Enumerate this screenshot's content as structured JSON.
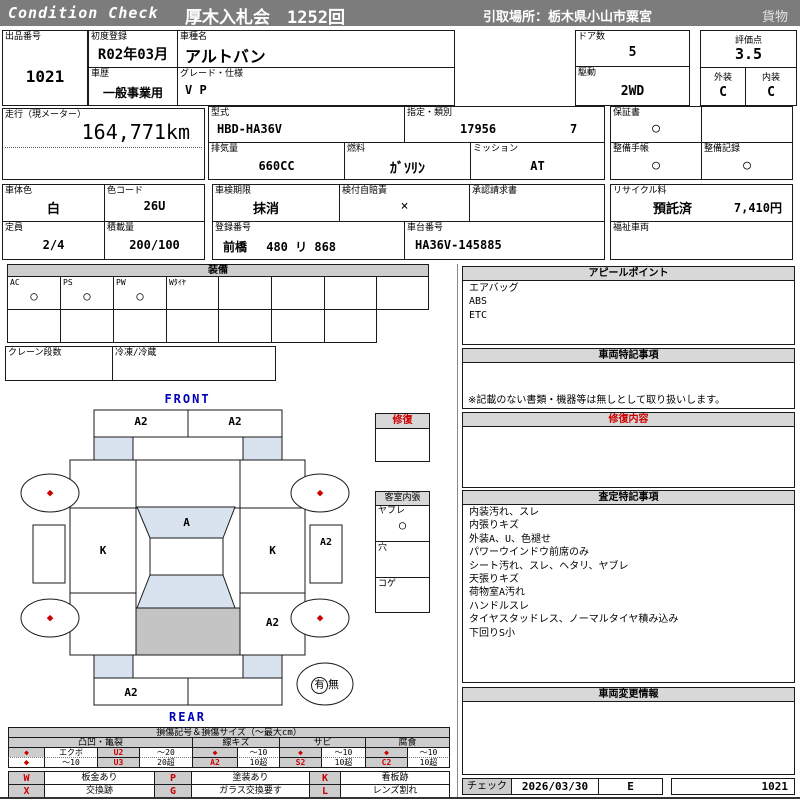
{
  "header": {
    "brand": "Condition Check",
    "auction": "厚木入札会　1252回",
    "pickup": "引取場所：栃木県小山市粟宮",
    "category": "貨物"
  },
  "vehicle": {
    "lot": {
      "label": "出品番号",
      "value": "1021"
    },
    "first_reg": {
      "label": "初度登録",
      "value": "R02年03月"
    },
    "history": {
      "label": "車歴",
      "value": "一般事業用"
    },
    "model_name": {
      "label": "車種名",
      "value": "アルトバン"
    },
    "grade": {
      "label": "グレード・仕様",
      "value": "V P"
    },
    "doors": {
      "label": "ドア数",
      "value": "5"
    },
    "drive": {
      "label": "駆動",
      "value": "2WD"
    },
    "score": {
      "label": "評価点",
      "value": "3.5"
    },
    "exterior": {
      "label": "外装",
      "value": "C"
    },
    "interior": {
      "label": "内装",
      "value": "C"
    },
    "mileage": {
      "label": "走行（現メーター）",
      "value": "164,771km"
    },
    "model_code": {
      "label": "型式",
      "value": "HBD-HA36V"
    },
    "type_class": {
      "label": "指定・類別",
      "type_no": "17956",
      "class_no": "7"
    },
    "displacement": {
      "label": "排気量",
      "value": "660CC"
    },
    "fuel": {
      "label": "燃料",
      "value": "ｶﾞｿﾘﾝ"
    },
    "mission": {
      "label": "ミッション",
      "value": "AT"
    },
    "warranty": {
      "label": "保証書",
      "value": "○"
    },
    "maint_book": {
      "label": "整備手帳",
      "value": "○"
    },
    "maint_record": {
      "label": "整備記録",
      "value": "○"
    },
    "body_color": {
      "label": "車体色",
      "value": "白"
    },
    "color_code": {
      "label": "色コード",
      "value": "26U"
    },
    "capacity": {
      "label": "定員",
      "value": "2/4"
    },
    "load": {
      "label": "積載量",
      "value": "200/100"
    },
    "inspection": {
      "label": "車検期限",
      "value": "抹消"
    },
    "insurance": {
      "label": "検付自賠責",
      "value": "×"
    },
    "approval": {
      "label": "承認請求書",
      "value": ""
    },
    "reg_no": {
      "label": "登録番号",
      "value": "前橋　 480 リ  868"
    },
    "chassis": {
      "label": "車台番号",
      "value": "HA36V-145885"
    },
    "recycle": {
      "label": "リサイクル料",
      "status": "預託済",
      "fee": "7,410円"
    },
    "welfare": {
      "label": "福祉車両",
      "value": ""
    }
  },
  "equipment": {
    "title": "装備",
    "slots": [
      {
        "label": "AC",
        "mark": "○"
      },
      {
        "label": "PS",
        "mark": "○"
      },
      {
        "label": "PW",
        "mark": "○"
      },
      {
        "label": "Wﾀｲﾔ",
        "mark": ""
      },
      {
        "label": "",
        "mark": ""
      },
      {
        "label": "",
        "mark": ""
      },
      {
        "label": "",
        "mark": ""
      },
      {
        "label": "",
        "mark": ""
      }
    ],
    "crane": {
      "label": "クレーン段数",
      "value": ""
    },
    "reefer": {
      "label": "冷凍/冷蔵",
      "value": ""
    }
  },
  "diagram": {
    "front": "FRONT",
    "rear": "REAR",
    "front_bumper_left": "A2",
    "front_bumper_right": "A2",
    "windshield": "A",
    "door_left": "K",
    "door_right": "K",
    "rear_quarter_right": "A2",
    "side_right": "A2",
    "rear_bumper_left": "A2",
    "wheel_mark": "◆",
    "spare_yes": "有",
    "spare_no": "無",
    "repair_box": {
      "title": "修復"
    },
    "cabin": {
      "title": "客室内張",
      "rows": [
        {
          "label": "ヤブレ",
          "mark": "○"
        },
        {
          "label": "穴",
          "mark": ""
        },
        {
          "label": "コゲ",
          "mark": ""
        }
      ]
    }
  },
  "panels": {
    "appeal": {
      "title": "アピールポイント",
      "lines": [
        "エアバッグ",
        "ABS",
        "ETC"
      ]
    },
    "special": {
      "title": "車両特記事項",
      "note": "※記載のない書類・機器等は無しとして取り扱いします。"
    },
    "repair": {
      "title": "修復内容"
    },
    "assessment": {
      "title": "査定特記事項",
      "lines": [
        "内装汚れ、スレ",
        "内張りキズ",
        "外装A、U、色褪せ",
        "パワーウインドウ前席のみ",
        "シート汚れ、スレ、ヘタリ、ヤブレ",
        "天張りキズ",
        "荷物室A汚れ",
        "ハンドルスレ",
        "タイヤスタッドレス、ノーマルタイヤ積み込み",
        "下回りS小"
      ]
    },
    "change": {
      "title": "車両変更情報"
    },
    "check": {
      "label": "チェック",
      "date": "2026/03/30",
      "code": "E",
      "lot": "1021"
    }
  },
  "legend": {
    "title": "損傷記号＆損傷サイズ（～最大cm）",
    "groups": [
      "凸凹・亀裂",
      "線キズ",
      "サビ",
      "腐食"
    ],
    "row1": [
      "◆",
      "エクボ",
      "U2",
      "～20",
      "◆",
      "～10",
      "◆",
      "～10",
      "◆",
      "～10"
    ],
    "row2": [
      "◆",
      "～10",
      "U3",
      "20超",
      "A2",
      "10超",
      "S2",
      "10超",
      "C2",
      "10超"
    ],
    "codes_row1": [
      {
        "code": "W",
        "desc": "板金あり"
      },
      {
        "code": "P",
        "desc": "塗装あり"
      },
      {
        "code": "K",
        "desc": "看板跡"
      }
    ],
    "codes_row2": [
      {
        "code": "X",
        "desc": "交換跡"
      },
      {
        "code": "G",
        "desc": "ガラス交換要す"
      },
      {
        "code": "L",
        "desc": "レンズ割れ"
      }
    ]
  },
  "colors": {
    "header_gray": "#7c7c7c",
    "section_gray": "#d8d8d8",
    "mark_red": "#cc0000",
    "glass_blue": "#d9e3ef",
    "cargo_gray": "#c4c4c4",
    "label_blue": "#0000b4"
  }
}
